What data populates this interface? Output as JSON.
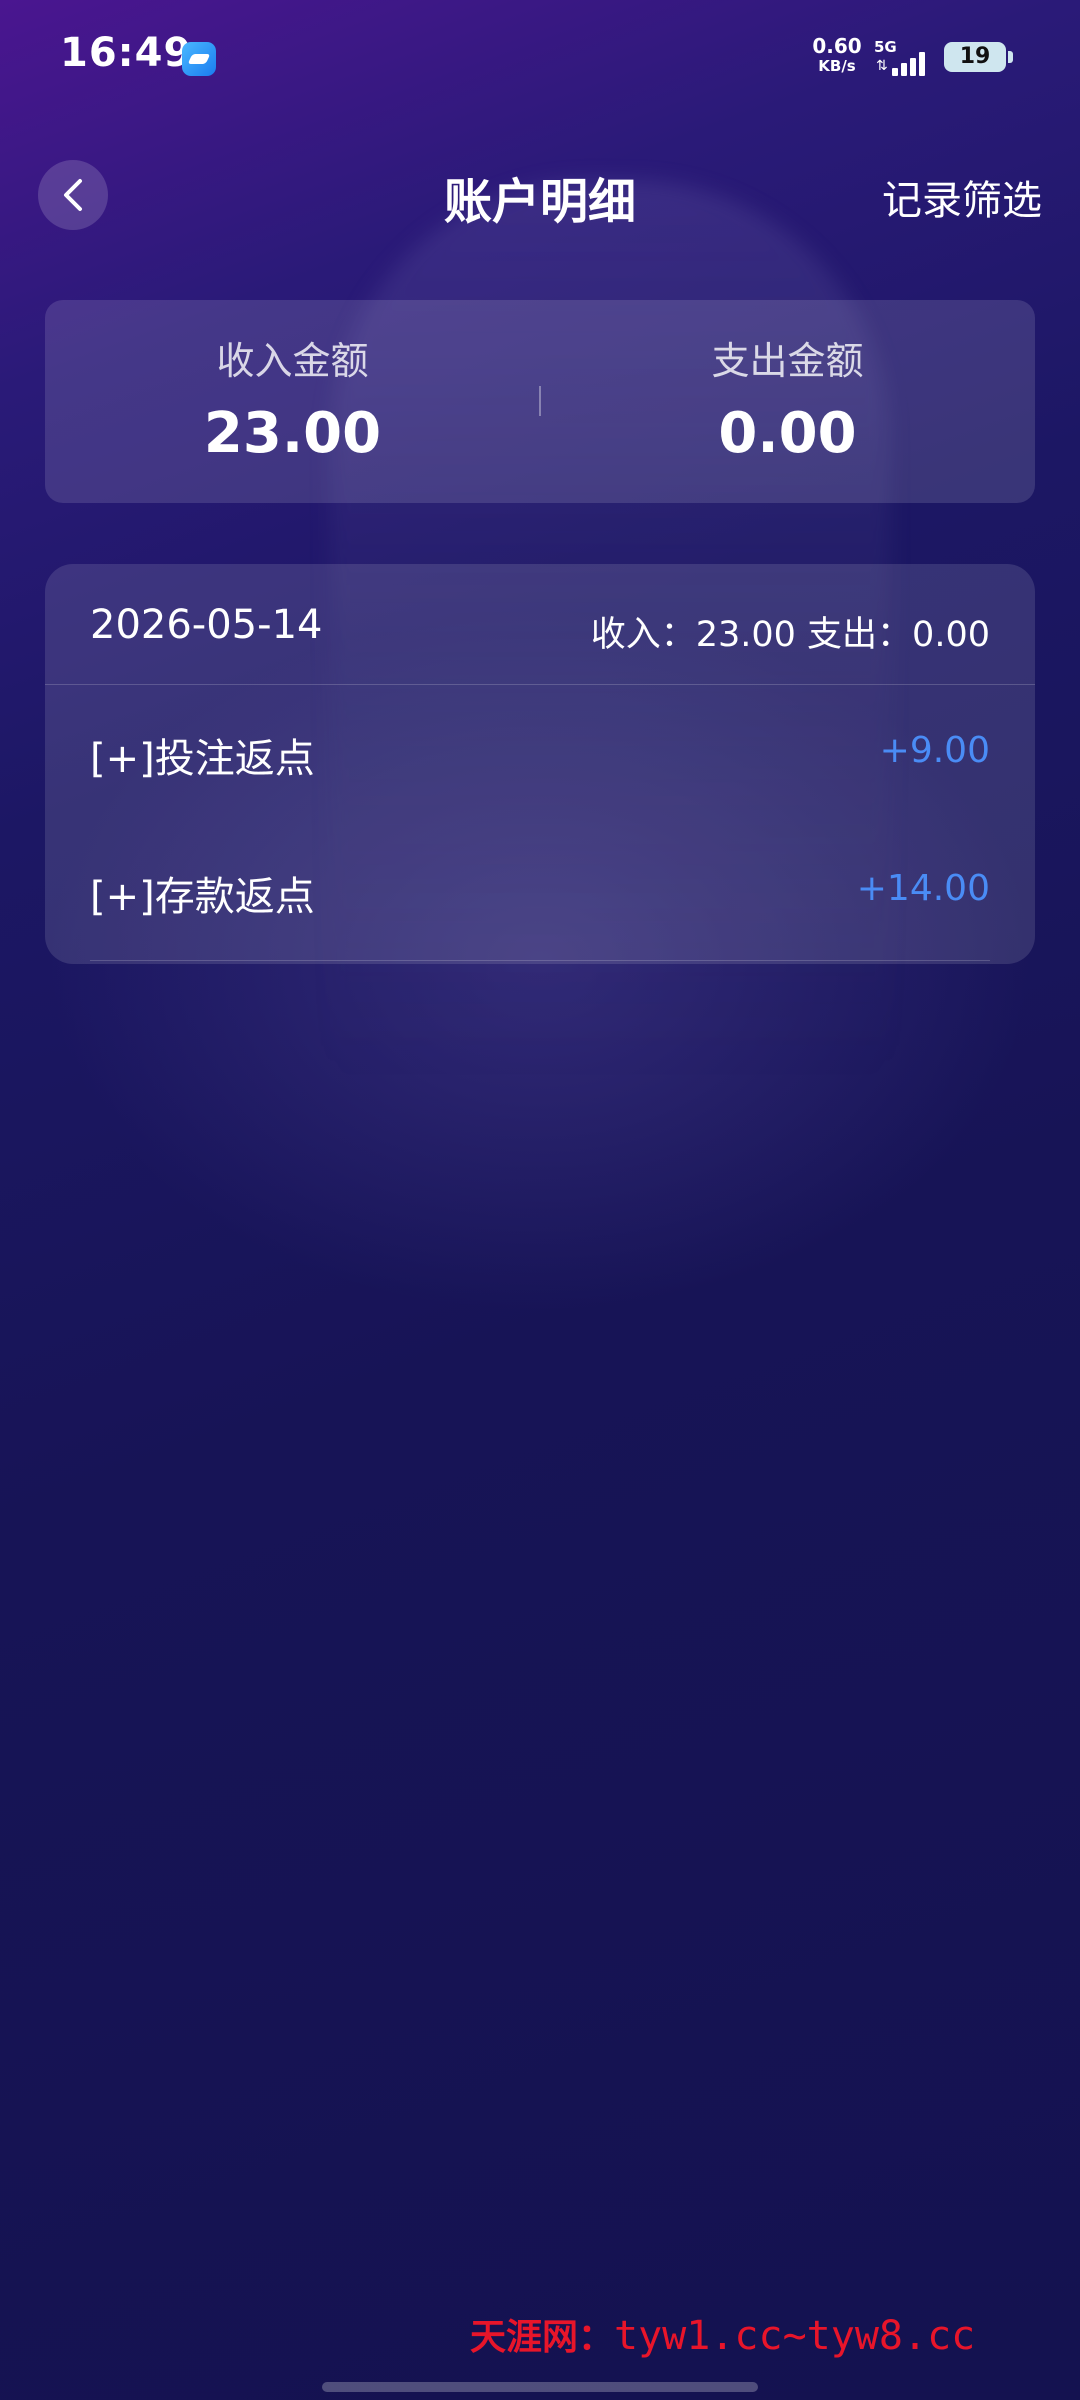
{
  "status_bar": {
    "time": "16:49",
    "net_speed_value": "0.60",
    "net_speed_unit": "KB/s",
    "network_type": "5G",
    "battery": "19",
    "icons": [
      "app-notification-icon",
      "signal-icon",
      "battery-icon"
    ]
  },
  "header": {
    "title": "账户明细",
    "filter_label": "记录筛选",
    "back_icon": "chevron-left-icon"
  },
  "summary": {
    "income_label": "收入金额",
    "income_value": "23.00",
    "expense_label": "支出金额",
    "expense_value": "0.00"
  },
  "records": {
    "date": "2026-05-14",
    "day_summary": "收入：23.00 支出：0.00",
    "items": [
      {
        "title": "[+]投注返点",
        "amount": "+9.00"
      },
      {
        "title": "[+]存款返点",
        "amount": "+14.00"
      }
    ]
  },
  "watermark": {
    "name": "天涯网：",
    "url": "tyw1.cc~tyw8.cc"
  },
  "colors": {
    "accent_amount": "#4a8cf5",
    "watermark": "#e8152a",
    "background_top": "#4a1690",
    "background_bottom": "#141250"
  }
}
